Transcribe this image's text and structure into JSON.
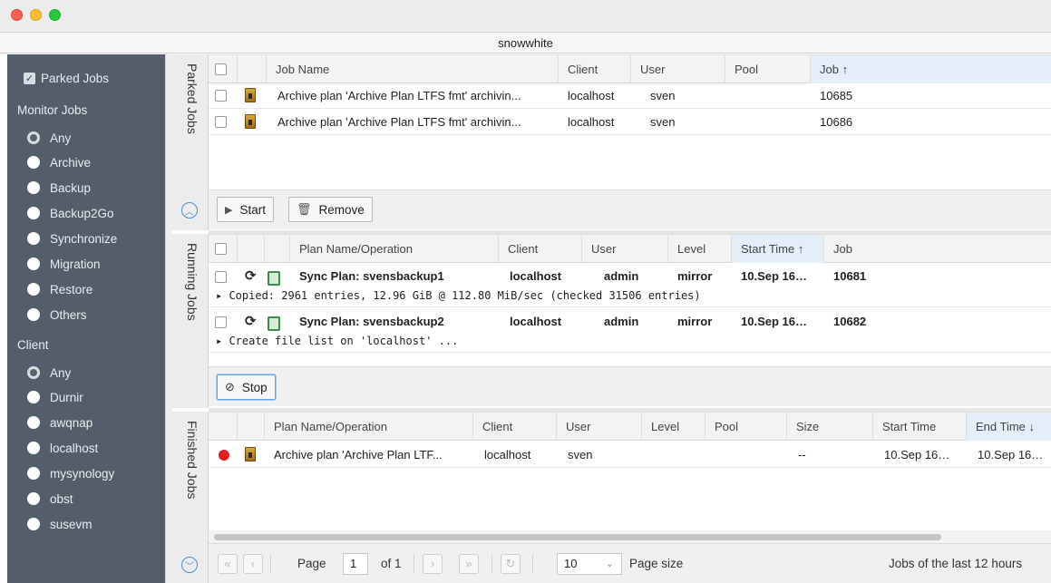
{
  "window": {
    "title": "snowwhite"
  },
  "sidebar": {
    "parked_jobs_label": "Parked Jobs",
    "monitor_jobs_heading": "Monitor Jobs",
    "monitor_options": [
      "Any",
      "Archive",
      "Backup",
      "Backup2Go",
      "Synchronize",
      "Migration",
      "Restore",
      "Others"
    ],
    "monitor_selected": "Any",
    "client_heading": "Client",
    "client_options": [
      "Any",
      "Durnir",
      "awqnap",
      "localhost",
      "mysynology",
      "obst",
      "susevm"
    ],
    "client_selected": "Any"
  },
  "parked": {
    "section_label": "Parked Jobs",
    "columns": {
      "job_name": "Job Name",
      "client": "Client",
      "user": "User",
      "pool": "Pool",
      "job": "Job ↑"
    },
    "rows": [
      {
        "job_name": "Archive plan 'Archive Plan LTFS fmt' archivin...",
        "client": "localhost",
        "user": "sven",
        "pool": "",
        "job": "10685"
      },
      {
        "job_name": "Archive plan 'Archive Plan LTFS fmt' archivin...",
        "client": "localhost",
        "user": "sven",
        "pool": "",
        "job": "10686"
      }
    ],
    "start_label": "Start",
    "remove_label": "Remove"
  },
  "running": {
    "section_label": "Running Jobs",
    "columns": {
      "plan": "Plan Name/Operation",
      "client": "Client",
      "user": "User",
      "level": "Level",
      "start_time": "Start Time ↑",
      "job": "Job"
    },
    "rows": [
      {
        "plan": "Sync Plan: svensbackup1",
        "client": "localhost",
        "user": "admin",
        "level": "mirror",
        "start_time": "10.Sep 16…",
        "job": "10681",
        "detail": "▸ Copied: 2961 entries, 12.96 GiB @ 112.80 MiB/sec (checked 31506 entries)"
      },
      {
        "plan": "Sync Plan: svensbackup2",
        "client": "localhost",
        "user": "admin",
        "level": "mirror",
        "start_time": "10.Sep 16…",
        "job": "10682",
        "detail": "▸ Create file list on 'localhost' ..."
      }
    ],
    "stop_label": "Stop"
  },
  "finished": {
    "section_label": "Finished Jobs",
    "columns": {
      "plan": "Plan Name/Operation",
      "client": "Client",
      "user": "User",
      "level": "Level",
      "pool": "Pool",
      "size": "Size",
      "start_time": "Start Time",
      "end_time": "End Time ↓"
    },
    "rows": [
      {
        "status": "error",
        "plan": "Archive plan 'Archive Plan LTF...",
        "client": "localhost",
        "user": "sven",
        "level": "",
        "pool": "",
        "size": "--",
        "start_time": "10.Sep 16…",
        "end_time": "10.Sep 16…"
      }
    ]
  },
  "pager": {
    "page_label": "Page",
    "page_value": "1",
    "of_label": "of 1",
    "page_size_value": "10",
    "page_size_label": "Page size",
    "jobs_range_label": "Jobs of the last 12 hours"
  },
  "colors": {
    "sidebar_bg": "#545e6a",
    "accent": "#4c8fd0",
    "sorted_header": "#e3eef9",
    "error": "#e02020"
  }
}
